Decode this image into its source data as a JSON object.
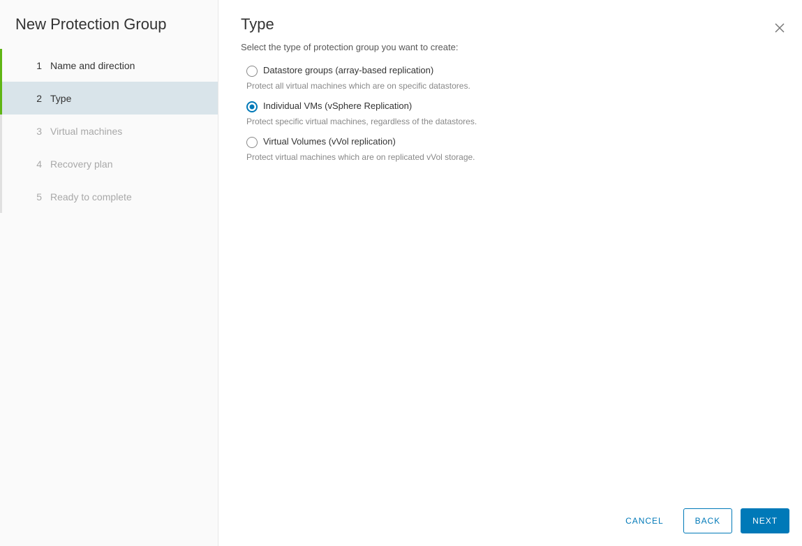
{
  "sidebar": {
    "title": "New Protection Group",
    "steps": [
      {
        "num": "1",
        "label": "Name and direction",
        "state": "completed"
      },
      {
        "num": "2",
        "label": "Type",
        "state": "active"
      },
      {
        "num": "3",
        "label": "Virtual machines",
        "state": "pending"
      },
      {
        "num": "4",
        "label": "Recovery plan",
        "state": "pending"
      },
      {
        "num": "5",
        "label": "Ready to complete",
        "state": "pending"
      }
    ]
  },
  "main": {
    "title": "Type",
    "subtitle": "Select the type of protection group you want to create:",
    "options": [
      {
        "label": "Datastore groups (array-based replication)",
        "description": "Protect all virtual machines which are on specific datastores.",
        "selected": false
      },
      {
        "label": "Individual VMs (vSphere Replication)",
        "description": "Protect specific virtual machines, regardless of the datastores.",
        "selected": true
      },
      {
        "label": "Virtual Volumes (vVol replication)",
        "description": "Protect virtual machines which are on replicated vVol storage.",
        "selected": false
      }
    ]
  },
  "footer": {
    "cancel": "CANCEL",
    "back": "BACK",
    "next": "NEXT"
  }
}
